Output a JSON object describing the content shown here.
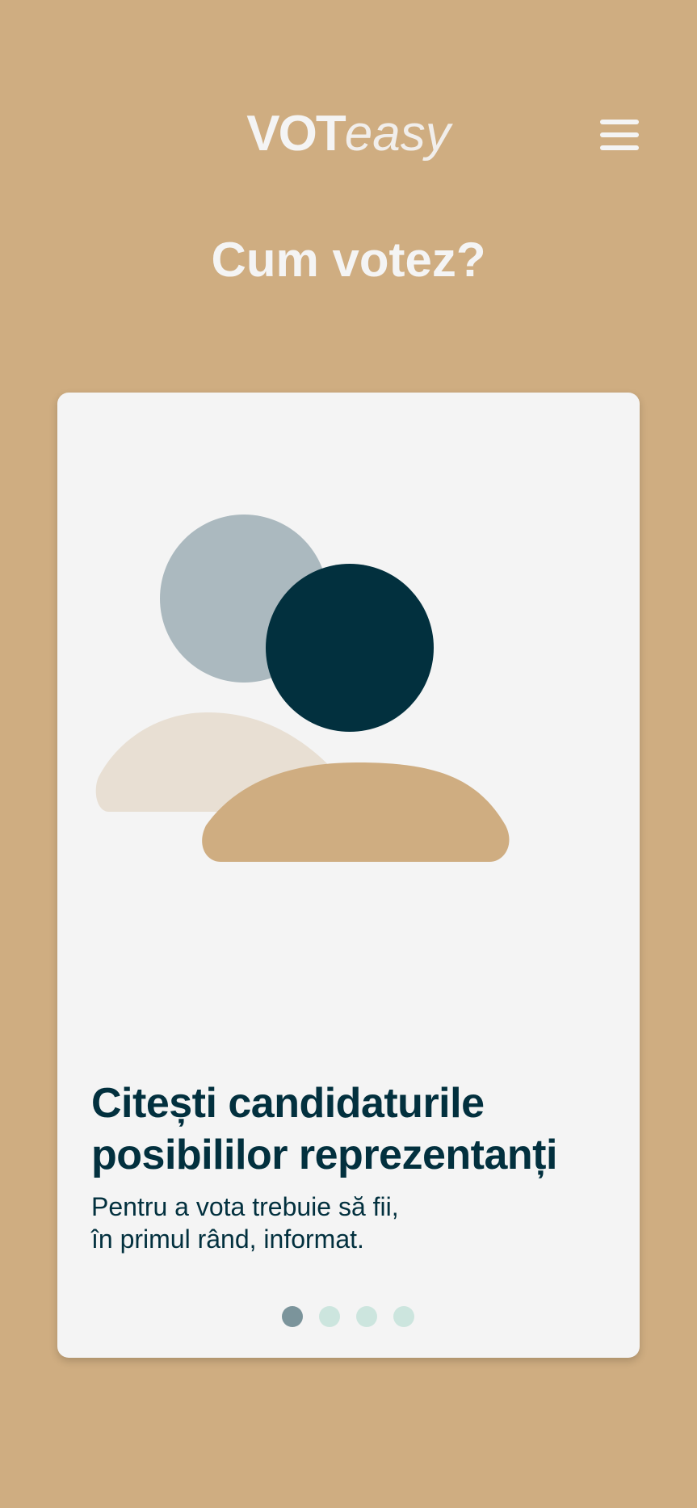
{
  "header": {
    "logo_bold": "VOT",
    "logo_light": "easy",
    "menu_icon": "hamburger-menu-icon"
  },
  "page": {
    "title": "Cum votez?"
  },
  "carousel": {
    "illustration": "people-icon",
    "heading_line1": "Citești candidaturile",
    "heading_line2": "posibililor reprezentanți",
    "body_line1": "Pentru a vota trebuie să fii,",
    "body_line2": "în primul rând, informat.",
    "slide_count": 4,
    "active_slide": 1
  },
  "colors": {
    "background": "#CFAD81",
    "card": "#F4F4F4",
    "text_dark": "#02303E",
    "header_text": "#F4F4F4",
    "dot_active": "#7B949B",
    "dot_inactive": "#CCE5DE",
    "shape_light_circle": "#ABB9BF",
    "shape_light_body": "#E8DFD3",
    "shape_dark_circle": "#02303E",
    "shape_body": "#CFAD81"
  }
}
